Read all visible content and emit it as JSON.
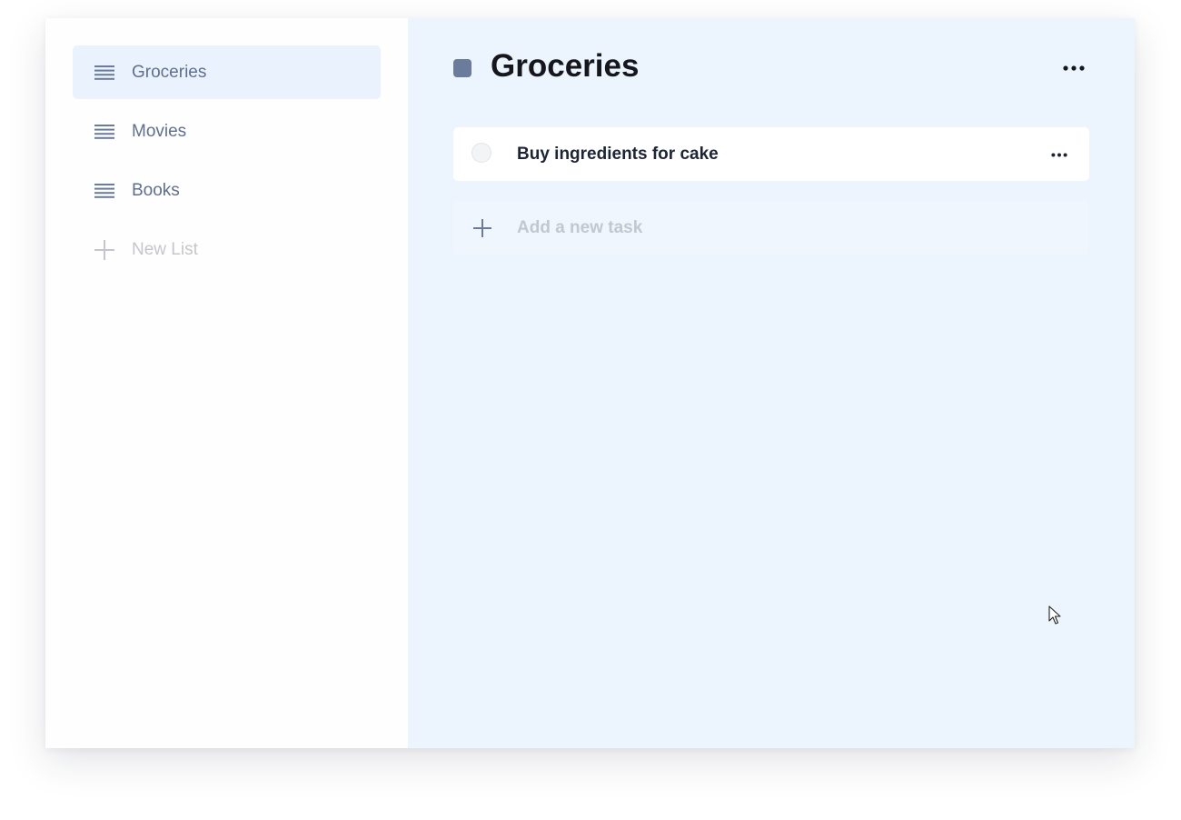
{
  "sidebar": {
    "items": [
      {
        "label": "Groceries",
        "icon": "list-icon",
        "active": true
      },
      {
        "label": "Movies",
        "icon": "list-icon",
        "active": false
      },
      {
        "label": "Books",
        "icon": "list-icon",
        "active": false
      }
    ],
    "new_list": {
      "label": "New List",
      "icon": "plus-icon"
    }
  },
  "main": {
    "title": "Groceries",
    "list_color": "#6b7b9c",
    "tasks": [
      {
        "label": "Buy ingredients for cake",
        "completed": false
      }
    ],
    "add_task": {
      "placeholder": "Add a new task",
      "value": ""
    }
  },
  "colors": {
    "sidebar_bg": "#fefefe",
    "main_bg": "#ecf4fd",
    "active_item_bg": "#eaf3fd",
    "accent": "#5f6f8e"
  }
}
